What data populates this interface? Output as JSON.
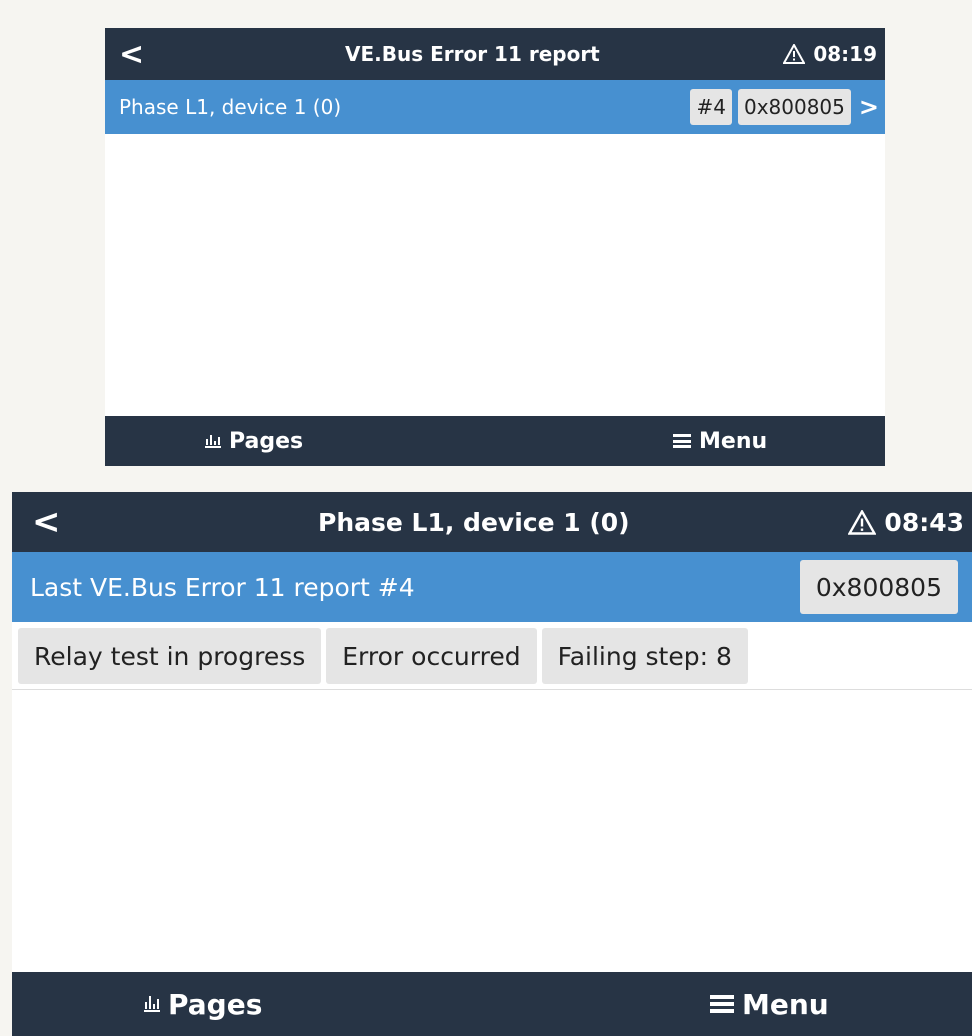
{
  "screen1": {
    "header": {
      "back": "<",
      "title": "VE.Bus Error 11 report",
      "time": "08:19"
    },
    "row": {
      "label": "Phase L1, device 1 (0)",
      "count": "#4",
      "code": "0x800805",
      "arrow": ">"
    },
    "footer": {
      "pages": "Pages",
      "menu": "Menu"
    }
  },
  "screen2": {
    "header": {
      "back": "<",
      "title": "Phase L1, device 1 (0)",
      "time": "08:43"
    },
    "row": {
      "label": "Last VE.Bus Error 11 report #4",
      "code": "0x800805"
    },
    "status": [
      "Relay test in progress",
      "Error occurred",
      "Failing step: 8"
    ],
    "footer": {
      "pages": "Pages",
      "menu": "Menu"
    }
  },
  "colors": {
    "header_bg": "#273445",
    "row_bg": "#4790d0",
    "chip_bg": "#e5e5e5"
  },
  "icons": [
    "back-chevron-icon",
    "warning-icon",
    "chevron-right-icon",
    "bar-chart-icon",
    "hamburger-menu-icon"
  ]
}
